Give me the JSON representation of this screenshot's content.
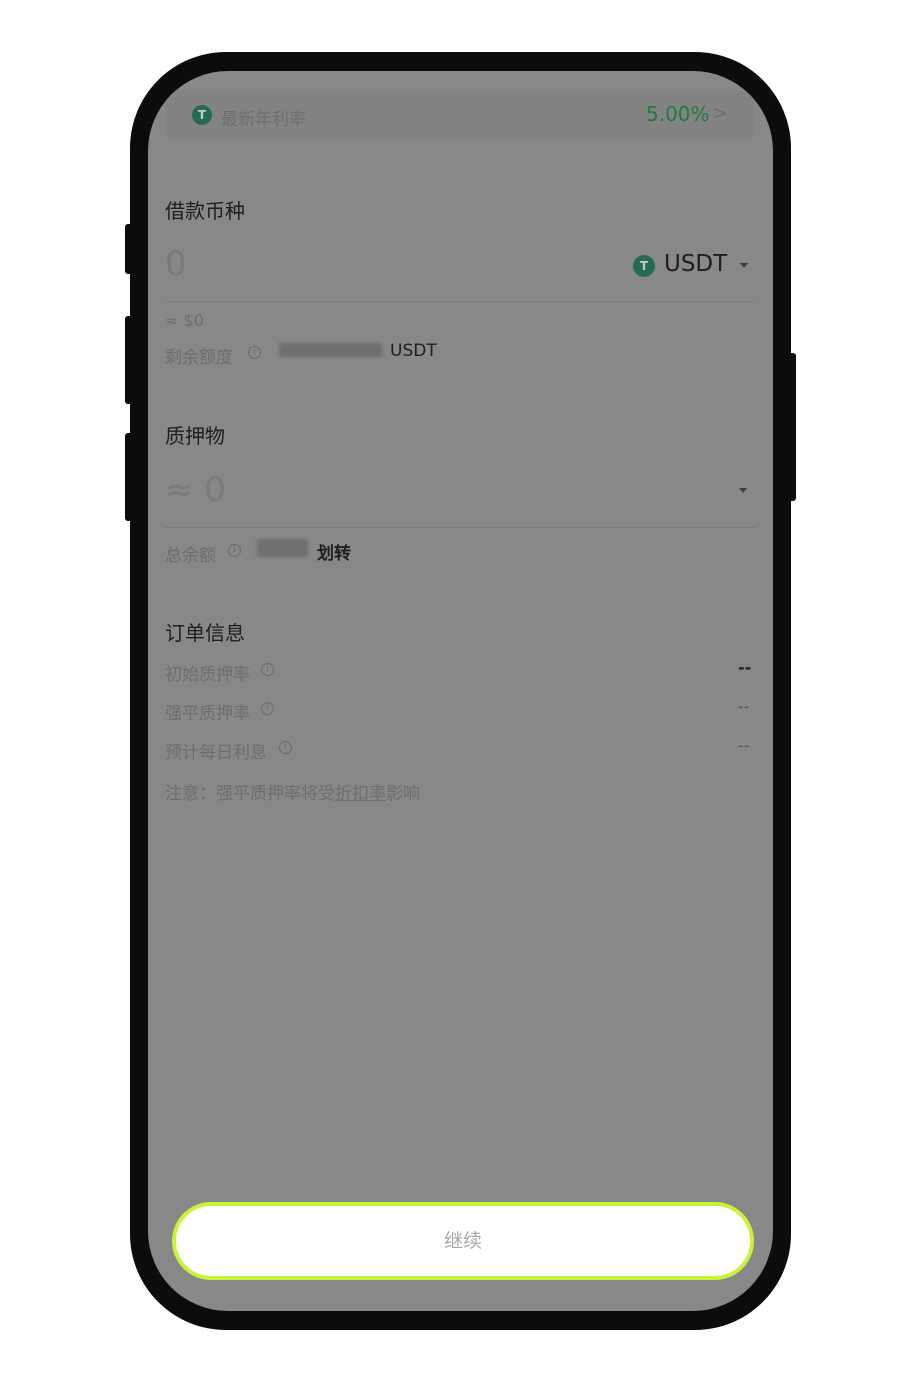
{
  "rate_bar": {
    "coin_glyph": "T",
    "label": "最新年利率",
    "value": "5.00%",
    "arrow": ">"
  },
  "borrow": {
    "title": "借款币种",
    "amount_placeholder": "0",
    "currency": "USDT",
    "usd_approx": "≈ $0",
    "remaining_label": "剩余额度",
    "remaining_unit": "USDT"
  },
  "collateral": {
    "title": "质押物",
    "amount_placeholder": "≈ 0",
    "total_balance_label": "总余额",
    "transfer_label": "划转"
  },
  "order_info": {
    "title": "订单信息",
    "rows": [
      {
        "label": "初始质押率",
        "value": "--"
      },
      {
        "label": "强平质押率",
        "value": "--"
      },
      {
        "label": "预计每日利息",
        "value": "--"
      }
    ],
    "note_prefix": "注意：强平质押率将受",
    "note_link": "折扣率",
    "note_suffix": "影响"
  },
  "continue_button": "继续",
  "icons": {
    "coin": "usdt-coin-icon",
    "info": "info-icon",
    "caret": "caret-down-icon",
    "chevron": "chevron-right-icon"
  },
  "colors": {
    "accent_green": "#1f7a43",
    "cta_border": "#c9f23a"
  }
}
